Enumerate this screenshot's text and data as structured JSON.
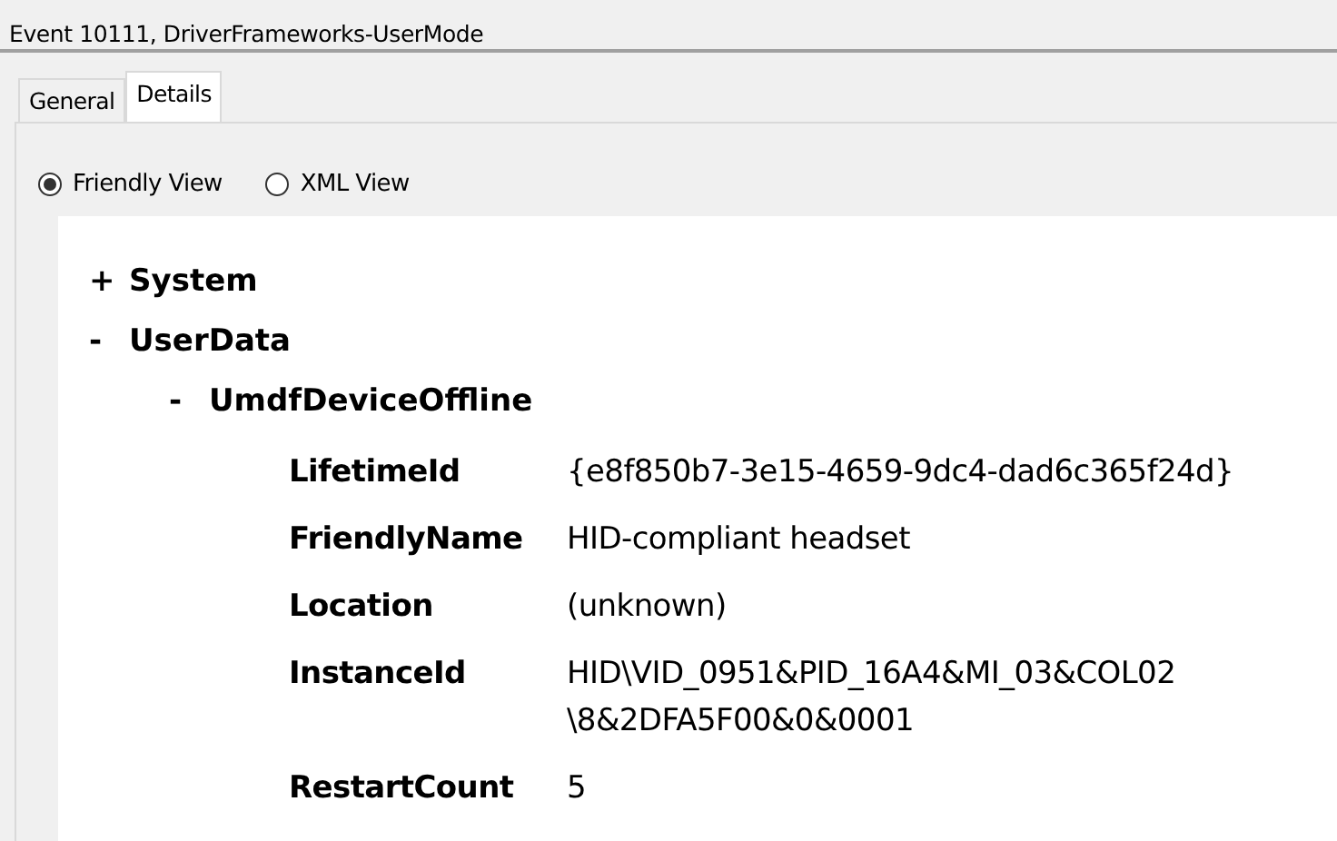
{
  "window": {
    "title": "Event 10111, DriverFrameworks-UserMode"
  },
  "tabs": [
    {
      "label": "General",
      "selected": false
    },
    {
      "label": "Details",
      "selected": true
    }
  ],
  "view_options": [
    {
      "label": "Friendly View",
      "selected": true
    },
    {
      "label": "XML View",
      "selected": false
    }
  ],
  "tree": [
    {
      "toggle": "+",
      "label": "System"
    },
    {
      "toggle": "-",
      "label": "UserData",
      "children": [
        {
          "toggle": "-",
          "label": "UmdfDeviceOffline",
          "properties": [
            {
              "name": "LifetimeId",
              "value_lines": [
                "{e8f850b7-3e15-4659-9dc4-dad6c365f24d}"
              ]
            },
            {
              "name": "FriendlyName",
              "value_lines": [
                "HID-compliant headset"
              ]
            },
            {
              "name": "Location",
              "value_lines": [
                "(unknown)"
              ]
            },
            {
              "name": "InstanceId",
              "value_lines": [
                "HID\\VID_0951&PID_16A4&MI_03&COL02",
                "\\8&2DFA5F00&0&0001"
              ]
            },
            {
              "name": "RestartCount",
              "value_lines": [
                "5"
              ]
            }
          ]
        }
      ]
    }
  ]
}
